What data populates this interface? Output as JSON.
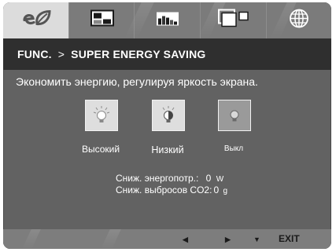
{
  "tabs": [
    {
      "icon": "eco-leaf-icon",
      "active": true
    },
    {
      "icon": "picture-icon",
      "active": false
    },
    {
      "icon": "color-bars-icon",
      "active": false
    },
    {
      "icon": "screen-layout-icon",
      "active": false
    },
    {
      "icon": "globe-icon",
      "active": false
    }
  ],
  "header": {
    "section": "FUNC.",
    "separator": ">",
    "title": "SUPER ENERGY SAVING"
  },
  "description": "Экономить энергию, регулируя яркость экрана.",
  "options": [
    {
      "label": "Высокий",
      "icon": "bulb-high-icon",
      "selected": true
    },
    {
      "label": "Низкий",
      "icon": "bulb-low-icon",
      "selected": true
    },
    {
      "label": "Выкл",
      "icon": "bulb-off-icon",
      "selected": false
    }
  ],
  "stats": {
    "power_label": "Сниж. энергопотр.:",
    "power_value": "0",
    "power_unit": "W",
    "co2_label": "Сниж. выбросов CO2:",
    "co2_value": "0",
    "co2_unit": "g"
  },
  "footer": {
    "left": "◀",
    "right": "▶",
    "down": "▼",
    "exit": "EXIT"
  },
  "colors": {
    "panel": "#626262",
    "tabbar": "#7b7b7b",
    "active_tab": "#dcdcdc",
    "titlebar": "#2f2f2f"
  }
}
